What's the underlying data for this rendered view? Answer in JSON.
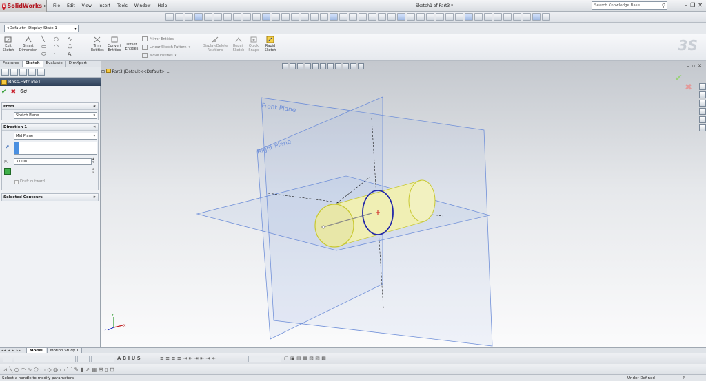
{
  "app": {
    "name": "SolidWorks",
    "doc_title": "Sketch1 of Part3 *",
    "menu": [
      "File",
      "Edit",
      "View",
      "Insert",
      "Tools",
      "Window",
      "Help"
    ],
    "search_placeholder": "Search Knowledge Base"
  },
  "config": {
    "display_state": "<Default>_Display State 1"
  },
  "commands": {
    "exit_sketch": "Exit Sketch",
    "smart_dimension": "Smart Dimension",
    "trim_entities": "Trim Entities",
    "convert_entities": "Convert Entities",
    "offset_entities": "Offset Entities",
    "mirror_entities": "Mirror Entities",
    "linear_pattern": "Linear Sketch Pattern",
    "move_entities": "Move Entities",
    "display_delete": "Display/Delete Relations",
    "repair_sketch": "Repair Sketch",
    "quick_snaps": "Quick Snaps",
    "rapid_sketch": "Rapid Sketch"
  },
  "tabs": [
    "Features",
    "Sketch",
    "Evaluate",
    "DimXpert"
  ],
  "active_tab": "Sketch",
  "property_manager": {
    "title": "Boss-Extrude1",
    "from": {
      "header": "From",
      "value": "Sketch Plane"
    },
    "direction1": {
      "header": "Direction 1",
      "end_condition": "Mid Plane",
      "depth": "3.00in",
      "draft_label": "Draft outward"
    },
    "selected_contours": {
      "header": "Selected Contours"
    }
  },
  "viewport": {
    "breadcrumb": "Part3  (Default<<Default>_...",
    "front_plane": "Front Plane",
    "right_plane": "Right Plane",
    "triad": {
      "x": "X",
      "y": "Y",
      "z": "Z"
    }
  },
  "bottom_tabs": [
    "Model",
    "Motion Study 1"
  ],
  "status": {
    "message": "Select a handle to modify parameters",
    "definition": "Under Defined",
    "help": "?"
  },
  "colors": {
    "plane": "#6f8fd8",
    "body": "#f0efb4",
    "body_edge": "#c8c830",
    "sketch_circle": "#2328a8",
    "header": "#2d3f57"
  }
}
